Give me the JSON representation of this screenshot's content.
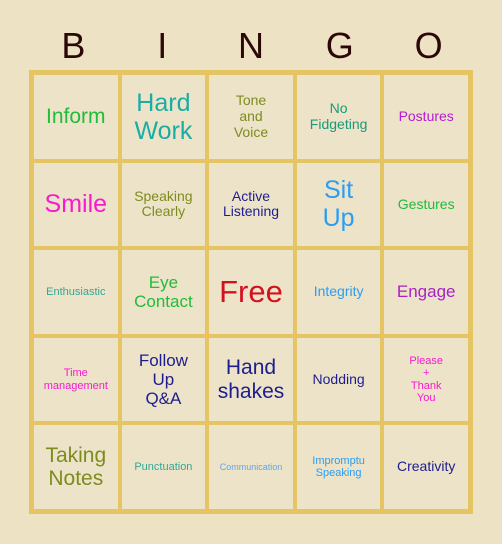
{
  "header": {
    "letters": [
      "B",
      "I",
      "N",
      "G",
      "O"
    ]
  },
  "colors": {
    "page_background": "#ede2c3",
    "cell_background": "#ede3c8",
    "grid_border": "#e5c464",
    "header_letter": "#2b0707"
  },
  "grid": {
    "rows": 5,
    "columns": 5,
    "cells": [
      {
        "text": "Inform",
        "color": "#22bb3b",
        "size": "sz-xl"
      },
      {
        "text": "Hard\nWork",
        "color": "#1aada3",
        "size": "sz-xxl"
      },
      {
        "text": "Tone\nand\nVoice",
        "color": "#7d8c1e",
        "size": "sz-md"
      },
      {
        "text": "No\nFidgeting",
        "color": "#179a77",
        "size": "sz-md"
      },
      {
        "text": "Postures",
        "color": "#b81ad6",
        "size": "sz-md"
      },
      {
        "text": "Smile",
        "color": "#f81ad0",
        "size": "sz-xxl"
      },
      {
        "text": "Speaking\nClearly",
        "color": "#7d8c1e",
        "size": "sz-md"
      },
      {
        "text": "Active\nListening",
        "color": "#1d1d8f",
        "size": "sz-md"
      },
      {
        "text": "Sit\nUp",
        "color": "#2a9df4",
        "size": "sz-xxl"
      },
      {
        "text": "Gestures",
        "color": "#1fba3a",
        "size": "sz-md"
      },
      {
        "text": "Enthusiastic",
        "color": "#2fa896",
        "size": "sz-sm"
      },
      {
        "text": "Eye\nContact",
        "color": "#22bb3b",
        "size": "sz-lg"
      },
      {
        "text": "Free",
        "color": "#d31220",
        "size": "sz-huge"
      },
      {
        "text": "Integrity",
        "color": "#2a9df4",
        "size": "sz-md"
      },
      {
        "text": "Engage",
        "color": "#a822c4",
        "size": "sz-lg"
      },
      {
        "text": "Time\nmanagement",
        "color": "#f81ad0",
        "size": "sz-sm"
      },
      {
        "text": "Follow\nUp\nQ&A",
        "color": "#1d1d8f",
        "size": "sz-lg"
      },
      {
        "text": "Hand\nshakes",
        "color": "#1d1d8f",
        "size": "sz-xl"
      },
      {
        "text": "Nodding",
        "color": "#1d1d8f",
        "size": "sz-md"
      },
      {
        "text": "Please\n+\nThank\nYou",
        "color": "#f81ad0",
        "size": "sz-sm"
      },
      {
        "text": "Taking\nNotes",
        "color": "#7d8c1e",
        "size": "sz-xl"
      },
      {
        "text": "Punctuation",
        "color": "#2fa896",
        "size": "sz-sm"
      },
      {
        "text": "Communication",
        "color": "#5fa8e8",
        "size": "sz-xs"
      },
      {
        "text": "Impromptu\nSpeaking",
        "color": "#2a9df4",
        "size": "sz-sm"
      },
      {
        "text": "Creativity",
        "color": "#1d1d8f",
        "size": "sz-md"
      }
    ]
  }
}
